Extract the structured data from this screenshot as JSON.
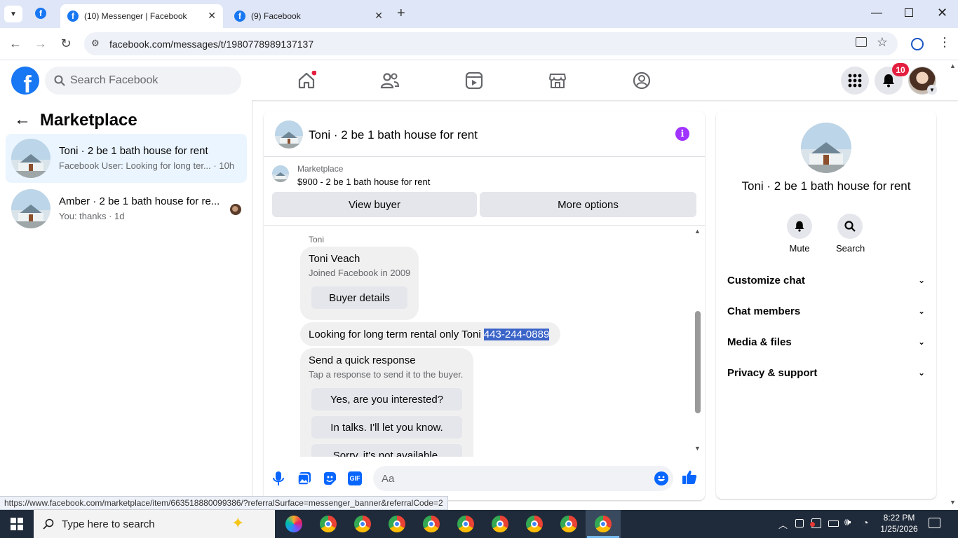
{
  "browser": {
    "tabs": [
      {
        "title": "(10) Messenger | Facebook",
        "active": true
      },
      {
        "title": "(9) Facebook",
        "active": false
      }
    ],
    "url": "facebook.com/messages/t/1980778989137137",
    "status_url": "https://www.facebook.com/marketplace/item/663518880099386/?referralSurface=messenger_banner&referralCode=2"
  },
  "fb": {
    "search_placeholder": "Search Facebook",
    "notification_count": "10"
  },
  "left": {
    "title": "Marketplace",
    "conversations": [
      {
        "name": "Toni · 2 be 1 bath house for rent",
        "snippet": "Facebook User: Looking for long ter...",
        "time": "· 10h",
        "selected": true
      },
      {
        "name": "Amber · 2 be 1 bath house for re...",
        "snippet": "You: thanks",
        "time": "· 1d",
        "selected": false
      }
    ]
  },
  "chat": {
    "title": "Toni · 2 be 1 bath house for rent",
    "listing_source": "Marketplace",
    "listing": "$900 - 2 be 1 bath house for rent",
    "view_buyer": "View buyer",
    "more_options": "More options",
    "sender": "Toni",
    "card": {
      "name": "Toni Veach",
      "joined": "Joined Facebook in 2009",
      "button": "Buyer details"
    },
    "message_text": "Looking for long term rental only Toni ",
    "message_phone": "443-244-0889",
    "quick": {
      "title": "Send a quick response",
      "subtitle": "Tap a response to send it to the buyer.",
      "options": [
        "Yes, are you interested?",
        "In talks. I'll let you know.",
        "Sorry, it's not available."
      ]
    },
    "composer_placeholder": "Aa"
  },
  "right": {
    "title": "Toni · 2 be 1 bath house for rent",
    "actions": [
      {
        "label": "Mute"
      },
      {
        "label": "Search"
      }
    ],
    "sections": [
      "Customize chat",
      "Chat members",
      "Media & files",
      "Privacy & support"
    ]
  },
  "taskbar": {
    "search_placeholder": "Type here to search",
    "time": "8:22 PM",
    "date": "1/25/2026"
  },
  "colors": {
    "fb_blue": "#1877f2",
    "info_purple": "#a033ff",
    "notification_red": "#e41e3f",
    "selection_highlight": "#3b64c8"
  }
}
